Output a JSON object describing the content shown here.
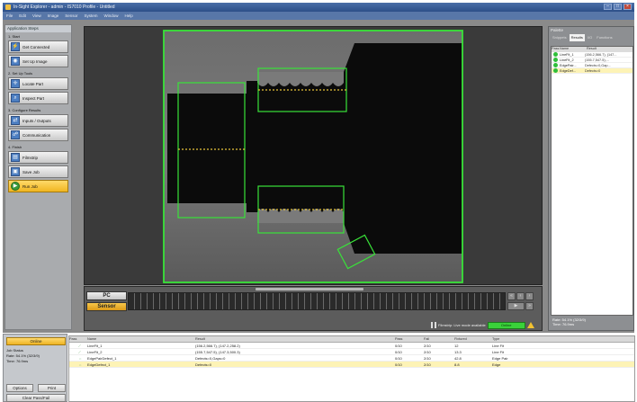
{
  "window": {
    "title": "In-Sight Explorer - admin - IS7010 Profile - Untitled",
    "controls": [
      "minimize-icon",
      "maximize-icon",
      "close-icon"
    ]
  },
  "menubar": [
    "File",
    "Edit",
    "View",
    "Image",
    "Sensor",
    "System",
    "Window",
    "Help"
  ],
  "steps": {
    "title": "Application Steps",
    "groups": [
      {
        "label": "1. Start",
        "items": [
          {
            "label": "Get Connected",
            "icon": "plug-icon"
          },
          {
            "label": "Set Up Image",
            "icon": "camera-icon"
          }
        ]
      },
      {
        "label": "2. Set Up Tools",
        "items": [
          {
            "label": "Locate Part",
            "icon": "crosshair-icon"
          },
          {
            "label": "Inspect Part",
            "icon": "magnifier-icon"
          }
        ]
      },
      {
        "label": "3. Configure Results",
        "items": [
          {
            "label": "Inputs / Outputs",
            "icon": "io-icon"
          },
          {
            "label": "Communication",
            "icon": "network-icon"
          }
        ]
      },
      {
        "label": "4. Finish",
        "items": [
          {
            "label": "Filmstrip",
            "icon": "film-icon"
          },
          {
            "label": "Save Job",
            "icon": "save-icon"
          },
          {
            "label": "Run Job",
            "icon": "run-icon"
          }
        ]
      }
    ]
  },
  "filmbar": {
    "pc_label": "PC",
    "sensor_label": "Sensor",
    "status_msg": "Filmstrip: Live mode available",
    "green_label": "Online"
  },
  "palette": {
    "title": "Palette",
    "tabs": [
      "Snippets",
      "Results",
      "I/O",
      "Functions"
    ],
    "active_tab": "Results",
    "headers": [
      "Pass",
      "Name",
      "Result"
    ],
    "rows": [
      {
        "name": "LineFit_1",
        "value": "(156.2,566.7), (147..."
      },
      {
        "name": "LineFit_2",
        "value": "(155.7,547.5),..."
      },
      {
        "name": "EdgePair...",
        "value": "Defects=0,Gap..."
      },
      {
        "name": "EdgeDef...",
        "value": "Defects=0"
      }
    ],
    "rate": "Rate: 54.1% (32/3/9)",
    "time": "Time: 76.9ms"
  },
  "bottomleft": {
    "online_label": "Online",
    "job_status_title": "Job Status",
    "rate": "Rate: 54.1% (32/3/9)",
    "time": "Time: 76.9ms",
    "options_label": "Options",
    "print_label": "Print",
    "clear_label": "Clear Pass/Fail"
  },
  "results": {
    "headers": {
      "pass": "Pass",
      "name": "Name",
      "result": "Result",
      "pass2": "Pass",
      "fail": "Fail",
      "fixture": "Fixtured",
      "type": "Type"
    },
    "rows": [
      {
        "name": "LineFit_1",
        "result": "(156.2,566.7), (147.2,258.2)",
        "pass": "0/10",
        "fail": "2/10",
        "fixture": "12",
        "type": "Line Fit"
      },
      {
        "name": "LineFit_2",
        "result": "(155.7,547.5), (147.3,500.3)",
        "pass": "0/10",
        "fail": "2/10",
        "fixture": "13.3",
        "type": "Line Fit"
      },
      {
        "name": "EdgePairDefect_1",
        "result": "Defects=0,Gaps=0",
        "pass": "0/10",
        "fail": "2/10",
        "fixture": "42.8",
        "type": "Edge Pair"
      },
      {
        "name": "EdgeDefect_1",
        "result": "Defects=0",
        "pass": "0/10",
        "fail": "2/10",
        "fixture": "8.8",
        "type": "Edge"
      }
    ]
  }
}
